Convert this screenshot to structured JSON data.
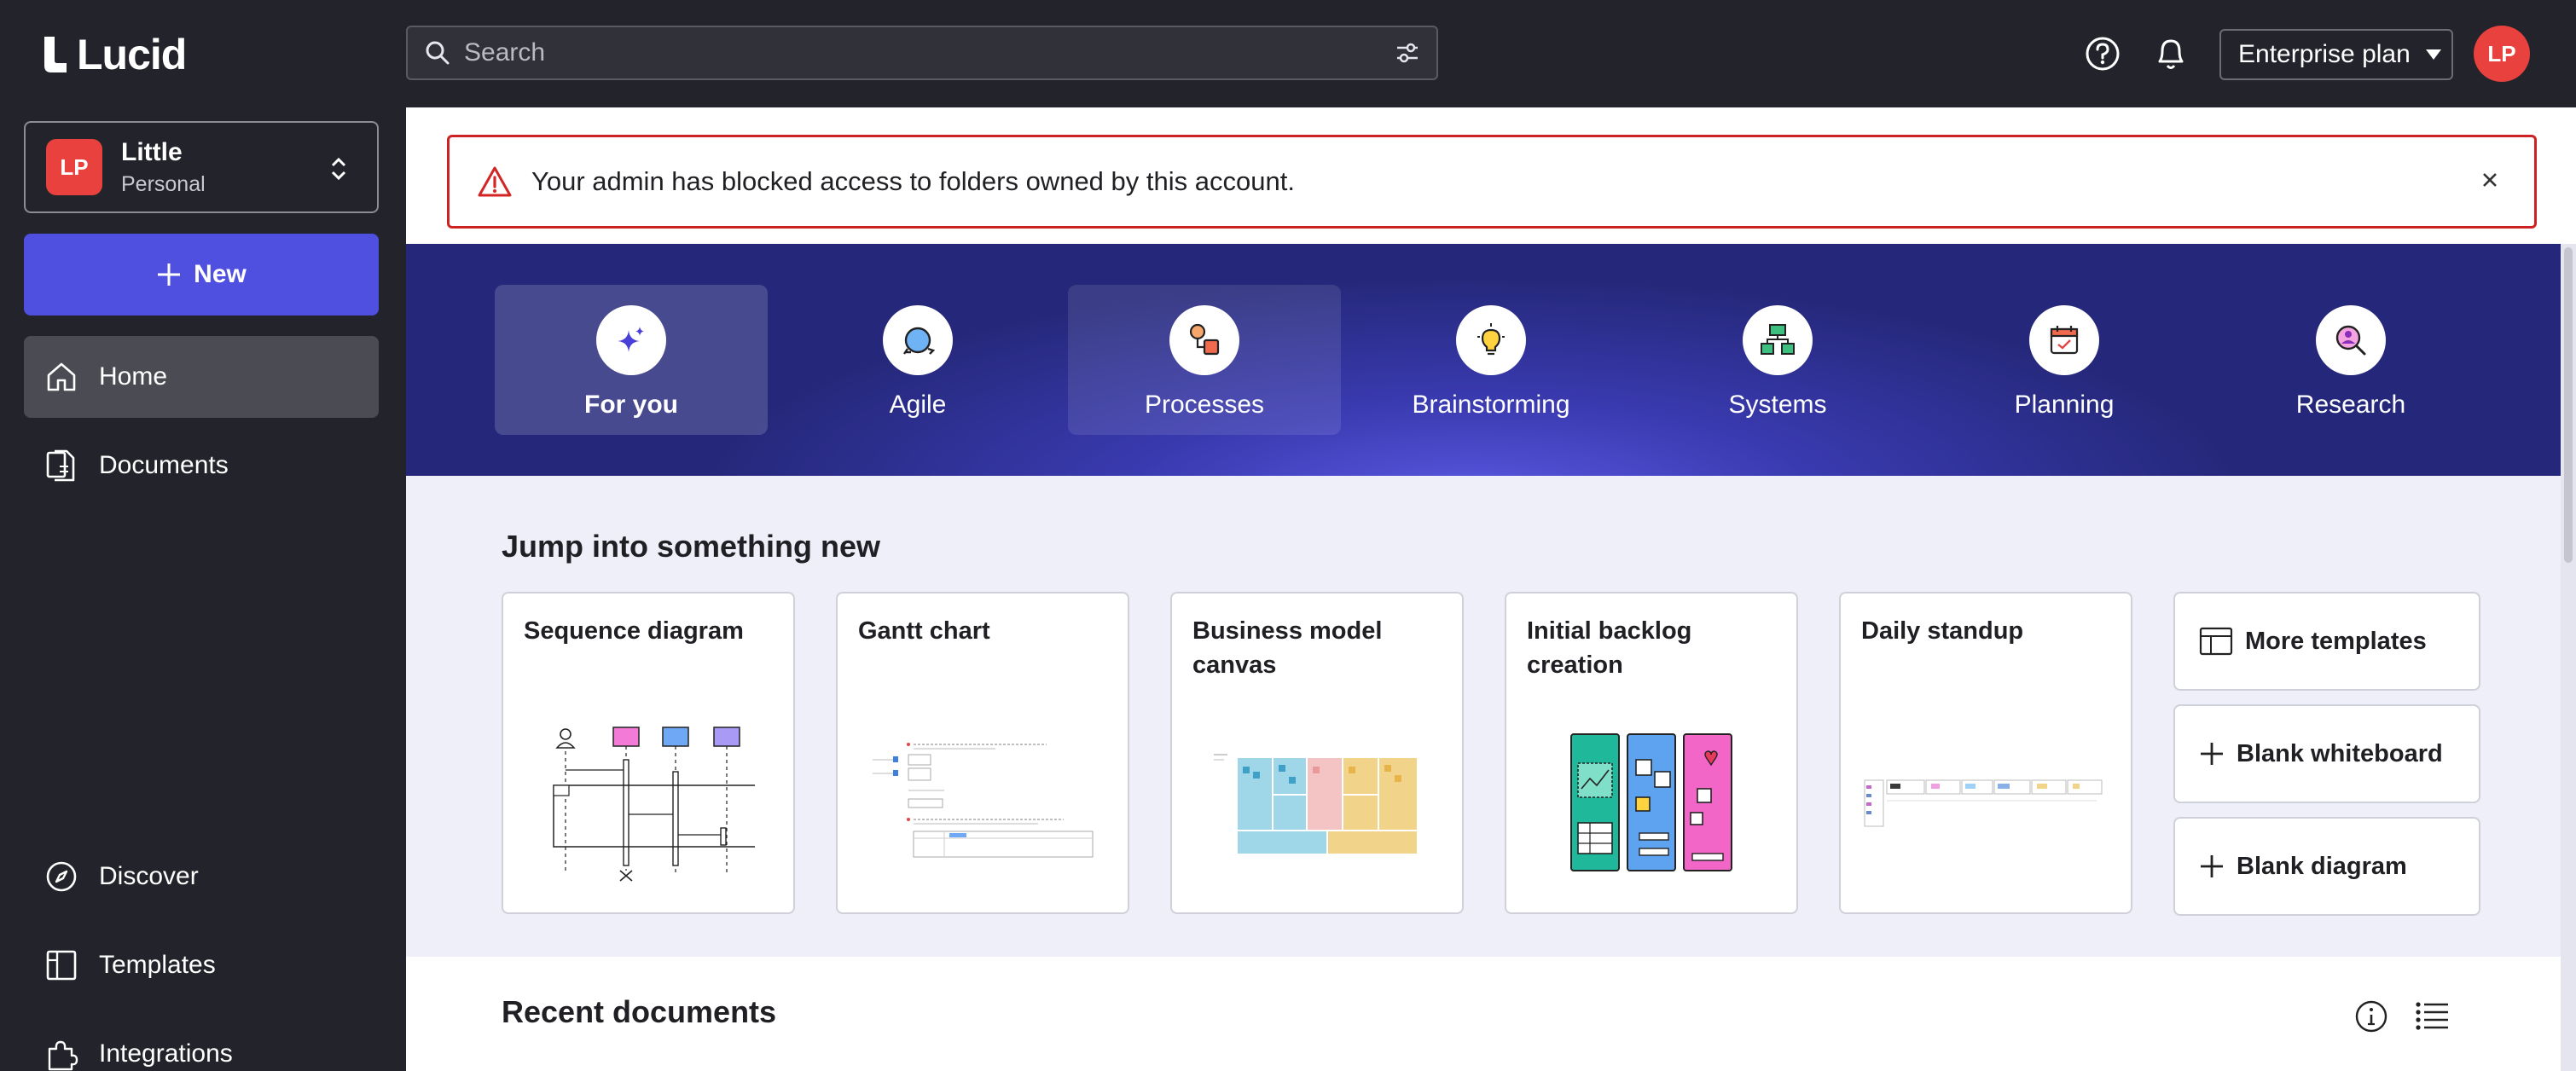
{
  "app": {
    "name": "Lucid"
  },
  "search": {
    "placeholder": "Search"
  },
  "header": {
    "plan_label": "Enterprise plan",
    "user_initials": "LP"
  },
  "account": {
    "initials": "LP",
    "name": "Little",
    "type": "Personal"
  },
  "sidebar": {
    "new_label": "New",
    "top_items": [
      {
        "label": "Home",
        "icon": "home-icon",
        "active": true
      },
      {
        "label": "Documents",
        "icon": "documents-icon",
        "active": false
      }
    ],
    "bottom_items": [
      {
        "label": "Discover",
        "icon": "compass-icon"
      },
      {
        "label": "Templates",
        "icon": "templates-icon"
      },
      {
        "label": "Integrations",
        "icon": "puzzle-icon"
      }
    ]
  },
  "alert": {
    "message": "Your admin has blocked access to folders owned by this account."
  },
  "categories": [
    {
      "label": "For you",
      "icon": "sparkle-icon"
    },
    {
      "label": "Agile",
      "icon": "agile-icon"
    },
    {
      "label": "Processes",
      "icon": "process-icon"
    },
    {
      "label": "Brainstorming",
      "icon": "lightbulb-icon"
    },
    {
      "label": "Systems",
      "icon": "systems-icon"
    },
    {
      "label": "Planning",
      "icon": "calendar-icon"
    },
    {
      "label": "Research",
      "icon": "research-icon"
    }
  ],
  "jump": {
    "title": "Jump into something new",
    "templates": [
      {
        "title": "Sequence diagram"
      },
      {
        "title": "Gantt chart"
      },
      {
        "title": "Business model canvas"
      },
      {
        "title": "Initial backlog creation"
      },
      {
        "title": "Daily standup"
      }
    ],
    "actions": [
      {
        "label": "More templates",
        "icon": "templates-icon"
      },
      {
        "label": "Blank whiteboard",
        "icon": "plus-icon"
      },
      {
        "label": "Blank diagram",
        "icon": "plus-icon"
      }
    ]
  },
  "recent": {
    "title": "Recent documents"
  },
  "colors": {
    "accent": "#5050e0",
    "alert": "#cc2222",
    "avatar": "#e8413e",
    "sidebar_bg": "#23242b"
  }
}
